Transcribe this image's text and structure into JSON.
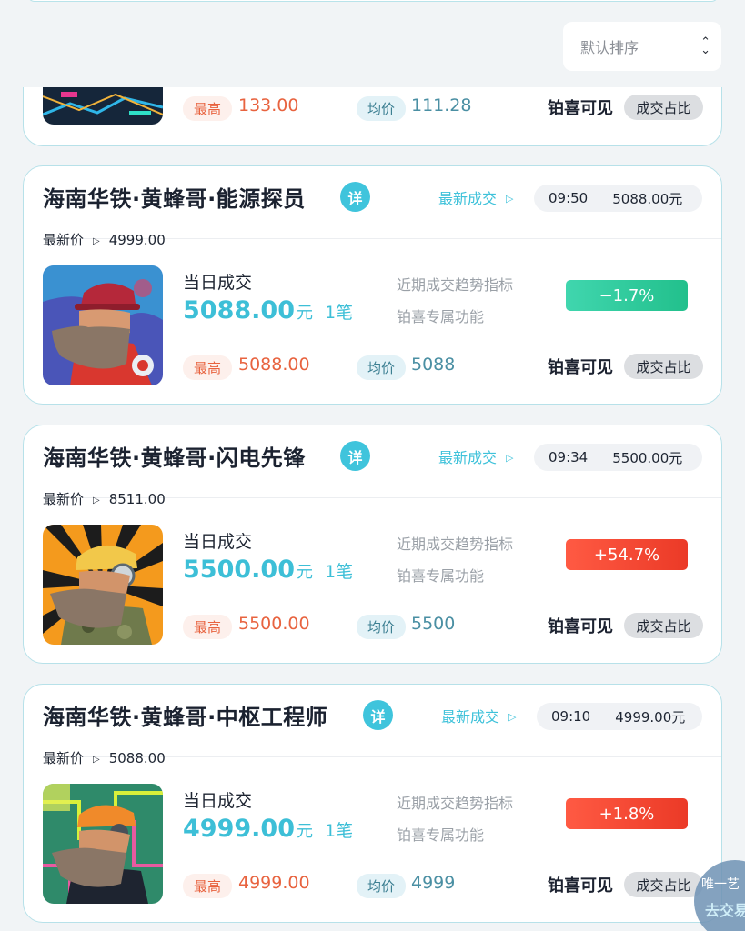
{
  "sort": {
    "label": "默认排序",
    "icon": "sort-chevrons-icon"
  },
  "partial_card": {
    "high_tag": "最高",
    "high_value": "133.00",
    "avg_tag": "均价",
    "avg_value": "111.28",
    "visibility": "铂喜可见",
    "share_btn": "成交占比"
  },
  "cards": [
    {
      "title": "海南华铁·黄蜂哥·能源探员",
      "detail_badge": "详",
      "latest_deal_label": "最新成交",
      "deal_time": "09:50",
      "deal_amount": "5088.00元",
      "last_price_label": "最新价",
      "last_price": "4999.00",
      "day_label": "当日成交",
      "day_amount": "5088.00",
      "day_unit": "元",
      "day_count": "1笔",
      "trend_label": "近期成交趋势指标",
      "exclusive_label": "铂喜专属功能",
      "change": "−1.7%",
      "change_direction": "down",
      "high_tag": "最高",
      "high_value": "5088.00",
      "avg_tag": "均价",
      "avg_value": "5088",
      "visibility": "铂喜可见",
      "share_btn": "成交占比"
    },
    {
      "title": "海南华铁·黄蜂哥·闪电先锋",
      "detail_badge": "详",
      "latest_deal_label": "最新成交",
      "deal_time": "09:34",
      "deal_amount": "5500.00元",
      "last_price_label": "最新价",
      "last_price": "8511.00",
      "day_label": "当日成交",
      "day_amount": "5500.00",
      "day_unit": "元",
      "day_count": "1笔",
      "trend_label": "近期成交趋势指标",
      "exclusive_label": "铂喜专属功能",
      "change": "+54.7%",
      "change_direction": "up",
      "high_tag": "最高",
      "high_value": "5500.00",
      "avg_tag": "均价",
      "avg_value": "5500",
      "visibility": "铂喜可见",
      "share_btn": "成交占比"
    },
    {
      "title": "海南华铁·黄蜂哥·中枢工程师",
      "detail_badge": "详",
      "latest_deal_label": "最新成交",
      "deal_time": "09:10",
      "deal_amount": "4999.00元",
      "last_price_label": "最新价",
      "last_price": "5088.00",
      "day_label": "当日成交",
      "day_amount": "4999.00",
      "day_unit": "元",
      "day_count": "1笔",
      "trend_label": "近期成交趋势指标",
      "exclusive_label": "铂喜专属功能",
      "change": "+1.8%",
      "change_direction": "up",
      "high_tag": "最高",
      "high_value": "4999.00",
      "avg_tag": "均价",
      "avg_value": "4999",
      "visibility": "铂喜可见",
      "share_btn": "成交占比"
    }
  ],
  "float_button": {
    "line1": "唯一艺",
    "line2": "去交易"
  },
  "colors": {
    "accent": "#3fc4dc",
    "high": "#e8633f",
    "up": "#eb3a27",
    "down": "#22c08c"
  }
}
